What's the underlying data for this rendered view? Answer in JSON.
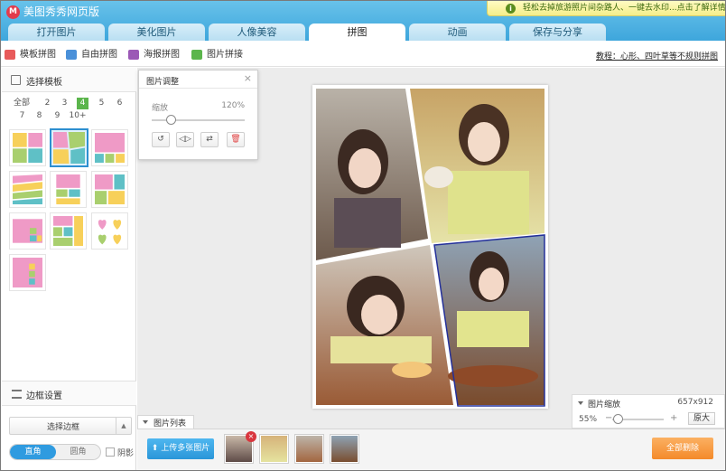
{
  "app": {
    "title": "美图秀秀网页版",
    "logo_glyph": "❶"
  },
  "promo": {
    "text": "轻松去掉旅游照片间杂路人、一键去水印...点击了解详情",
    "icon": "info-icon"
  },
  "tabs": [
    {
      "label": "打开图片"
    },
    {
      "label": "美化图片"
    },
    {
      "label": "人像美容"
    },
    {
      "label": "拼图",
      "active": true
    },
    {
      "label": "动画"
    },
    {
      "label": "保存与分享"
    }
  ],
  "subtoolbar": {
    "items": [
      {
        "label": "模板拼图",
        "color": "#e85a5a"
      },
      {
        "label": "自由拼图",
        "color": "#4a90d9"
      },
      {
        "label": "海报拼图",
        "color": "#9b59b6"
      },
      {
        "label": "图片拼接",
        "color": "#5bb54c"
      }
    ],
    "tutorial": "教程：心形、四叶草等不规则拼图"
  },
  "template_panel": {
    "title": "选择模板",
    "counts": [
      "全部",
      "2",
      "3",
      "4",
      "5",
      "6",
      "7",
      "8",
      "9",
      "10+"
    ],
    "active_count": "4"
  },
  "image_adjust": {
    "title": "图片调整",
    "close": "×",
    "zoom_label": "缩放",
    "zoom_value": "120%",
    "zoom_fraction": 0.2,
    "buttons": [
      {
        "name": "rotate-icon",
        "glyph": "↺"
      },
      {
        "name": "flip-icon",
        "glyph": "◁▷"
      },
      {
        "name": "swap-icon",
        "glyph": "⇄"
      },
      {
        "name": "delete-icon",
        "glyph": "🗑"
      }
    ]
  },
  "border_settings": {
    "title": "边框设置",
    "select_label": "选择边框",
    "corner_square": "直角",
    "corner_round": "圆角",
    "shadow_label": "阴影"
  },
  "zoom_panel": {
    "title": "图片缩放",
    "size": "657x912",
    "percent": "55%",
    "fraction": 0.05,
    "minus": "−",
    "plus": "+",
    "original": "原大"
  },
  "image_list": {
    "title": "图片列表",
    "upload_label": "上传多张图片",
    "thumbnail_count": 4,
    "delete_all": "全部删除"
  }
}
